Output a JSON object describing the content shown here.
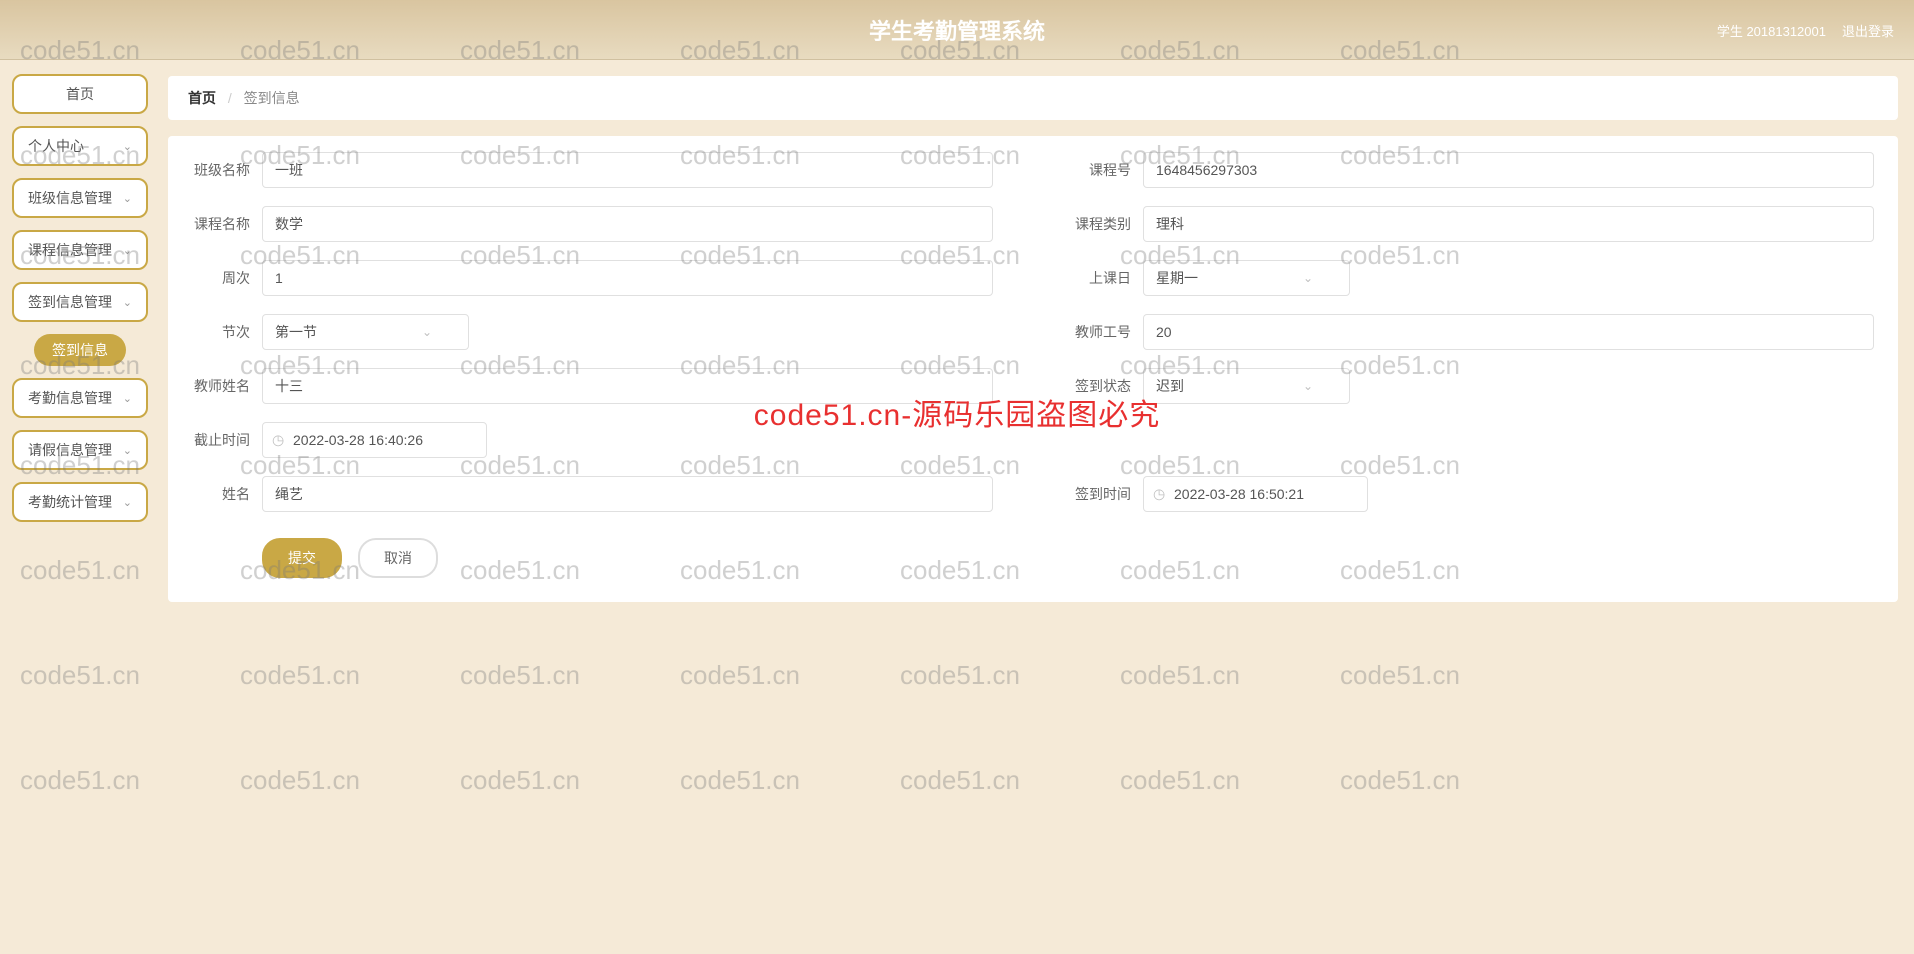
{
  "header": {
    "title": "学生考勤管理系统",
    "user_label": "学生 20181312001",
    "logout": "退出登录"
  },
  "sidebar": {
    "items": [
      {
        "label": "首页",
        "expandable": false
      },
      {
        "label": "个人中心",
        "expandable": true
      },
      {
        "label": "班级信息管理",
        "expandable": true
      },
      {
        "label": "课程信息管理",
        "expandable": true
      },
      {
        "label": "签到信息管理",
        "expandable": true,
        "expanded": true,
        "children": [
          "签到信息"
        ]
      },
      {
        "label": "考勤信息管理",
        "expandable": true
      },
      {
        "label": "请假信息管理",
        "expandable": true
      },
      {
        "label": "考勤统计管理",
        "expandable": true
      }
    ]
  },
  "breadcrumb": {
    "home": "首页",
    "current": "签到信息"
  },
  "form": {
    "class_name": {
      "label": "班级名称",
      "value": "一班"
    },
    "course_id": {
      "label": "课程号",
      "value": "1648456297303"
    },
    "course_name": {
      "label": "课程名称",
      "value": "数学"
    },
    "course_type": {
      "label": "课程类别",
      "value": "理科"
    },
    "week": {
      "label": "周次",
      "value": "1"
    },
    "class_day": {
      "label": "上课日",
      "value": "星期一"
    },
    "period": {
      "label": "节次",
      "value": "第一节"
    },
    "teacher_id": {
      "label": "教师工号",
      "value": "20"
    },
    "teacher_name": {
      "label": "教师姓名",
      "value": "十三"
    },
    "checkin_status": {
      "label": "签到状态",
      "value": "迟到"
    },
    "deadline": {
      "label": "截止时间",
      "value": "2022-03-28 16:40:26"
    },
    "student_name": {
      "label": "姓名",
      "value": "绳艺"
    },
    "checkin_time": {
      "label": "签到时间",
      "value": "2022-03-28 16:50:21"
    }
  },
  "actions": {
    "submit": "提交",
    "cancel": "取消"
  },
  "watermark": {
    "text": "code51.cn",
    "red_text": "code51.cn-源码乐园盗图必究"
  }
}
